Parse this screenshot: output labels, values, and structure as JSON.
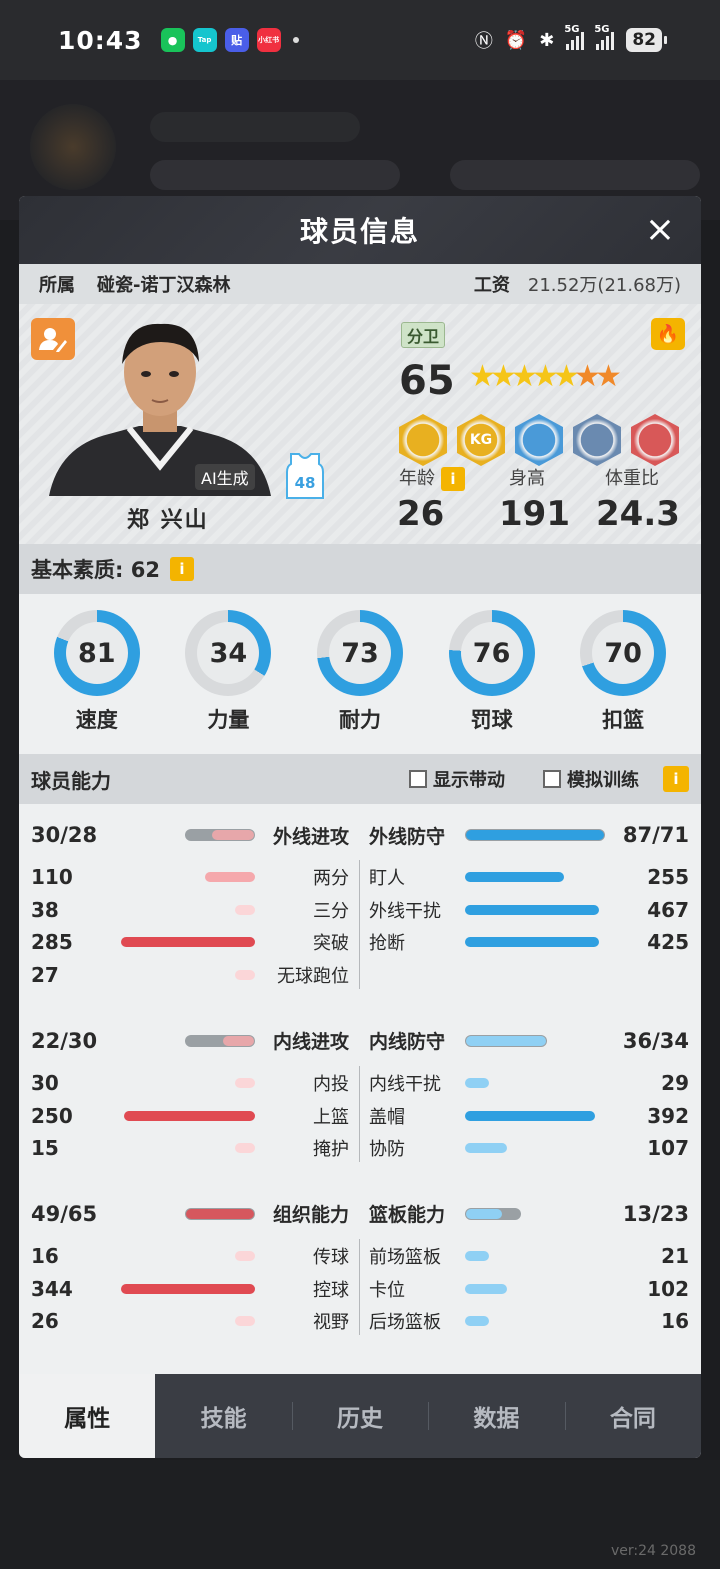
{
  "status_bar": {
    "time": "10:43",
    "apps": [
      {
        "name": "wechat-icon",
        "color": "#19c35a",
        "text": "●"
      },
      {
        "name": "taptap-icon",
        "color": "#15c5ce",
        "text": "Tap"
      },
      {
        "name": "tieba-icon",
        "color": "#4a5ee8",
        "text": "贴"
      },
      {
        "name": "xiaohongshu-icon",
        "color": "#f03040",
        "text": "小红书"
      }
    ],
    "battery": "82",
    "network1": "5G",
    "network2": "5G"
  },
  "background": {
    "version": "ver:24 2088"
  },
  "modal": {
    "title": "球员信息",
    "close": "×",
    "team_label": "所属",
    "team_name": "碰瓷-诺丁汉森林",
    "salary_label": "工资",
    "salary_value": "21.52万(21.68万)"
  },
  "player": {
    "position": "分卫",
    "rating": "65",
    "stars_full": 5,
    "stars_half": 2,
    "name": "郑 兴山",
    "ai_badge": "AI生成",
    "jersey_number": "48",
    "badges": [
      {
        "name": "gold-badge-1-icon",
        "color": "#e8b020",
        "text": ""
      },
      {
        "name": "gold-badge-kg-icon",
        "color": "#e8b020",
        "text": "KG"
      },
      {
        "name": "blue-badge-icon",
        "color": "#4a9ad8",
        "text": ""
      },
      {
        "name": "steel-badge-icon",
        "color": "#6a8ab0",
        "text": ""
      },
      {
        "name": "red-badge-icon",
        "color": "#d85858",
        "text": ""
      }
    ],
    "vitals": {
      "age_label": "年龄",
      "age": "26",
      "height_label": "身高",
      "height": "191",
      "bmi_label": "体重比",
      "bmi": "24.3"
    }
  },
  "basic": {
    "label": "基本素质: 62",
    "info": "i",
    "stats": [
      {
        "label": "速度",
        "value": "81",
        "pct": 0.81
      },
      {
        "label": "力量",
        "value": "34",
        "pct": 0.34
      },
      {
        "label": "耐力",
        "value": "73",
        "pct": 0.73
      },
      {
        "label": "罚球",
        "value": "76",
        "pct": 0.76
      },
      {
        "label": "扣篮",
        "value": "70",
        "pct": 0.7
      }
    ]
  },
  "ability": {
    "title": "球员能力",
    "show_dribble": "显示带动",
    "sim_training": "模拟训练",
    "info": "i",
    "groups": [
      {
        "left": {
          "name": "外线进攻",
          "value": "30/28",
          "fill": 0.3
        },
        "right": {
          "name": "外线防守",
          "value": "87/71",
          "fill": 0.87
        },
        "left_rows": [
          {
            "name": "两分",
            "value": "110",
            "fill": 0.3
          },
          {
            "name": "三分",
            "value": "38",
            "fill": 0.12
          },
          {
            "name": "突破",
            "value": "285",
            "fill": 0.8
          },
          {
            "name": "无球跑位",
            "value": "27",
            "fill": 0.09
          }
        ],
        "right_rows": [
          {
            "name": "盯人",
            "value": "255",
            "fill": 0.7
          },
          {
            "name": "外线干扰",
            "value": "467",
            "fill": 0.98
          },
          {
            "name": "抢断",
            "value": "425",
            "fill": 0.95
          }
        ]
      },
      {
        "left": {
          "name": "内线进攻",
          "value": "22/30",
          "fill": 0.22
        },
        "right": {
          "name": "内线防守",
          "value": "36/34",
          "fill": 0.36
        },
        "left_rows": [
          {
            "name": "内投",
            "value": "30",
            "fill": 0.1
          },
          {
            "name": "上篮",
            "value": "250",
            "fill": 0.78
          },
          {
            "name": "掩护",
            "value": "15",
            "fill": 0.06
          }
        ],
        "right_rows": [
          {
            "name": "内线干扰",
            "value": "29",
            "fill": 0.1
          },
          {
            "name": "盖帽",
            "value": "392",
            "fill": 0.92
          },
          {
            "name": "协防",
            "value": "107",
            "fill": 0.3
          }
        ]
      },
      {
        "left": {
          "name": "组织能力",
          "value": "49/65",
          "fill": 0.49
        },
        "right": {
          "name": "篮板能力",
          "value": "13/23",
          "fill": 0.13
        },
        "left_rows": [
          {
            "name": "传球",
            "value": "16",
            "fill": 0.06
          },
          {
            "name": "控球",
            "value": "344",
            "fill": 0.85
          },
          {
            "name": "视野",
            "value": "26",
            "fill": 0.09
          }
        ],
        "right_rows": [
          {
            "name": "前场篮板",
            "value": "21",
            "fill": 0.08
          },
          {
            "name": "卡位",
            "value": "102",
            "fill": 0.3
          },
          {
            "name": "后场篮板",
            "value": "16",
            "fill": 0.06
          }
        ]
      }
    ]
  },
  "tabs": [
    {
      "label": "属性",
      "active": true
    },
    {
      "label": "技能",
      "active": false
    },
    {
      "label": "历史",
      "active": false
    },
    {
      "label": "数据",
      "active": false
    },
    {
      "label": "合同",
      "active": false
    }
  ],
  "colors": {
    "accent_blue": "#2f9fe0",
    "light_blue": "#8fd0f4",
    "red": "#e04a52",
    "pink": "#f5a8ac",
    "light_pink": "#fbd6d8"
  }
}
